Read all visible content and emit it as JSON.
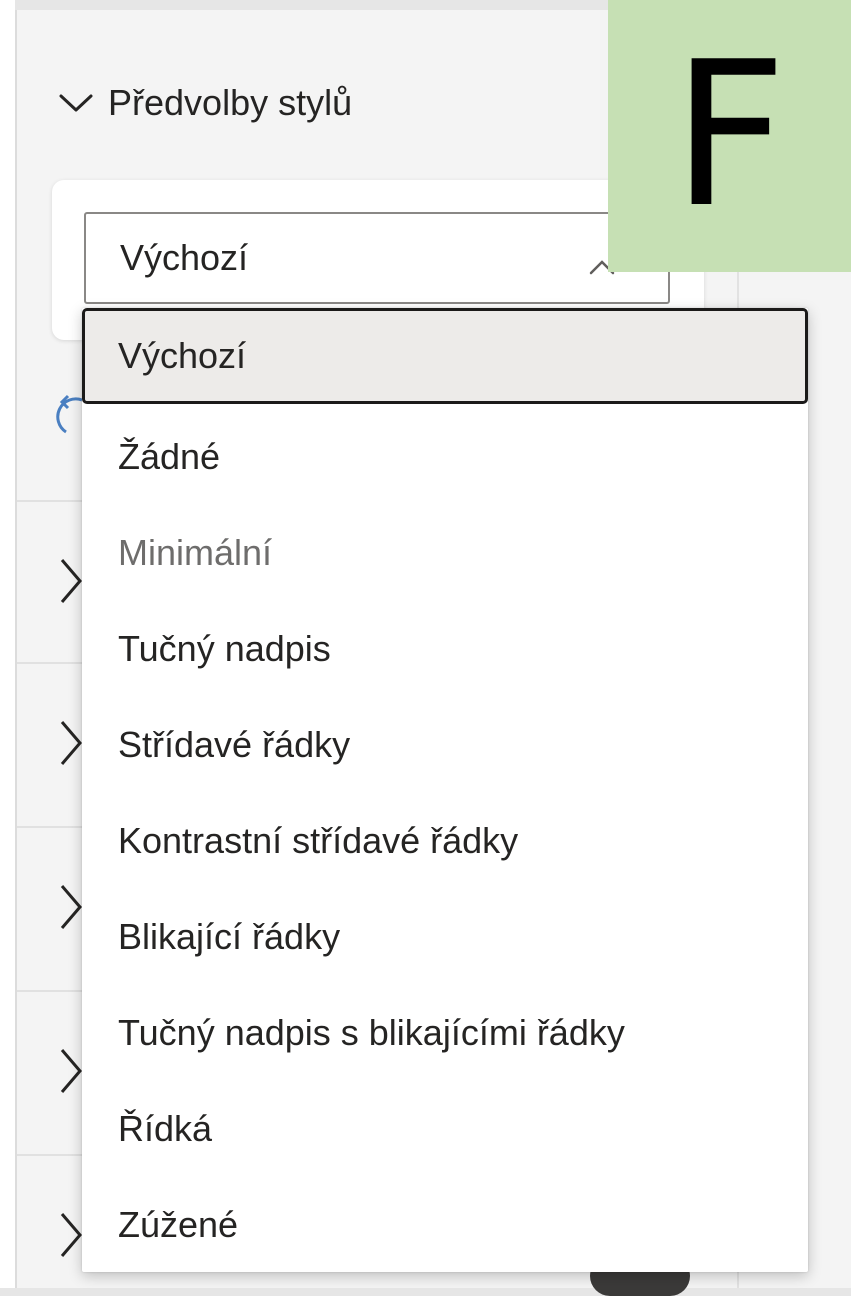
{
  "badge": {
    "letter": "F"
  },
  "section": {
    "title": "Předvolby stylů",
    "expand_icon": "chevron-down-icon"
  },
  "select": {
    "value": "Výchozí",
    "caret_icon": "chevron-up-icon"
  },
  "options": [
    {
      "label": "Výchozí",
      "selected": true
    },
    {
      "label": "Žádné"
    },
    {
      "label": "Minimální",
      "dimmed": true
    },
    {
      "label": "Tučný nadpis"
    },
    {
      "label": "Střídavé řádky"
    },
    {
      "label": "Kontrastní střídavé řádky"
    },
    {
      "label": "Blikající řádky"
    },
    {
      "label": "Tučný nadpis s blikajícími řádky"
    },
    {
      "label": "Řídká"
    },
    {
      "label": "Zúžené"
    }
  ],
  "colors": {
    "badge_bg": "#c6e0b4",
    "selected_bg": "#edebe9",
    "selected_border": "#1b1a19",
    "reset_icon": "#4a7fc1"
  }
}
